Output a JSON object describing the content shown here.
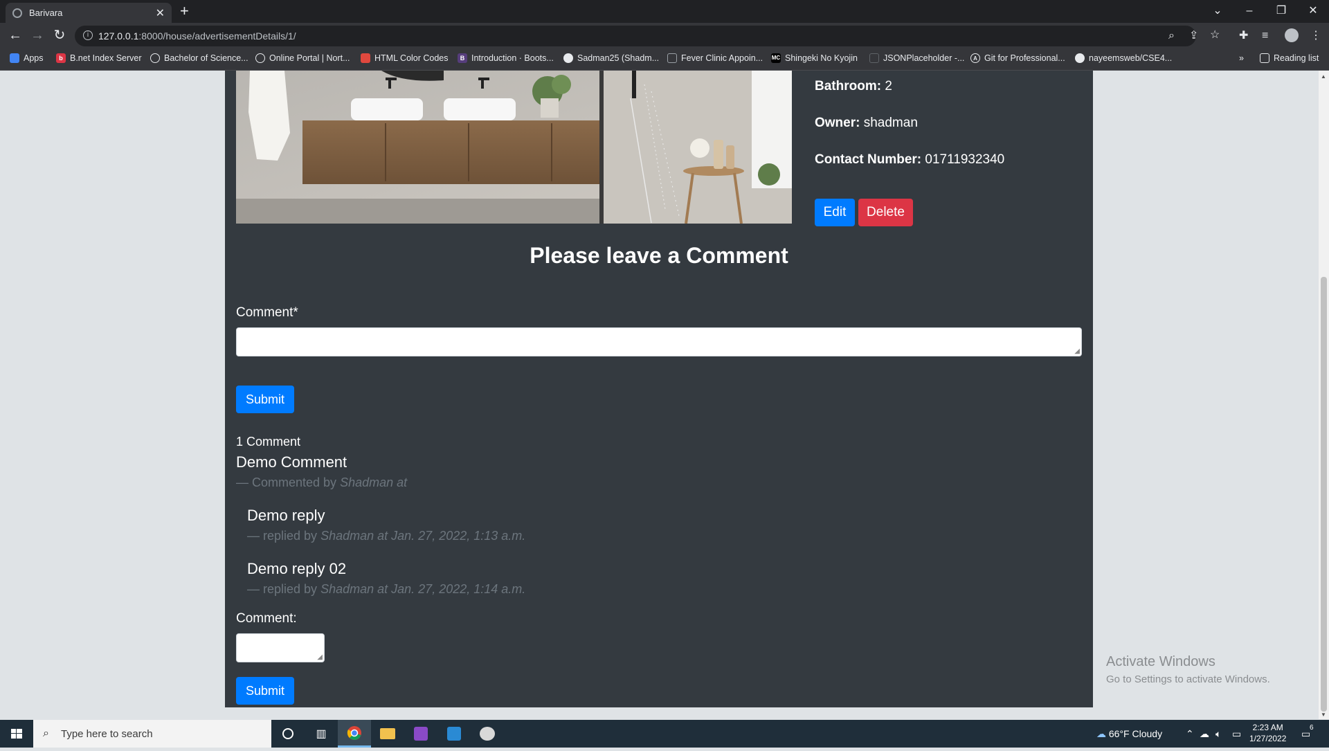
{
  "browser": {
    "tab_title": "Barivara",
    "url_host": "127.0.0.1",
    "url_rest": ":8000/house/advertisementDetails/1/",
    "bookmarks": [
      "Apps",
      "B.net Index Server",
      "Bachelor of Science...",
      "Online Portal | Nort...",
      "HTML Color Codes",
      "Introduction · Boots...",
      "Sadman25 (Shadm...",
      "Fever Clinic Appoin...",
      "Shingeki No Kyojin",
      "JSONPlaceholder -...",
      "Git for Professional...",
      "nayeemsweb/CSE4..."
    ],
    "reading_list": "Reading list"
  },
  "details": {
    "bathroom_label": "Bathroom:",
    "bathroom_value": "2",
    "owner_label": "Owner:",
    "owner_value": "shadman",
    "contact_label": "Contact Number:",
    "contact_value": "01711932340",
    "edit_label": "Edit",
    "delete_label": "Delete"
  },
  "comment_form": {
    "heading": "Please leave a Comment",
    "field_label": "Comment*",
    "submit_label": "Submit"
  },
  "comments": {
    "count_text": "1 Comment",
    "items": [
      {
        "text": "Demo Comment",
        "meta_prefix": "— Commented by",
        "author": "Shadman at",
        "replies": [
          {
            "text": "Demo reply",
            "meta_prefix": "— replied by",
            "author_date": "Shadman at Jan. 27, 2022, 1:13 a.m."
          },
          {
            "text": "Demo reply 02",
            "meta_prefix": "— replied by",
            "author_date": "Shadman at Jan. 27, 2022, 1:14 a.m."
          }
        ]
      }
    ],
    "reply_label": "Comment:",
    "reply_submit_label": "Submit"
  },
  "watermark": {
    "title": "Activate Windows",
    "subtitle": "Go to Settings to activate Windows."
  },
  "taskbar": {
    "search_placeholder": "Type here to search",
    "weather": "66°F  Cloudy",
    "time": "2:23 AM",
    "date": "1/27/2022",
    "notification_count": "6"
  },
  "colors": {
    "card_bg": "#343a40",
    "primary": "#007bff",
    "danger": "#dc3545",
    "muted": "#6c757d"
  }
}
